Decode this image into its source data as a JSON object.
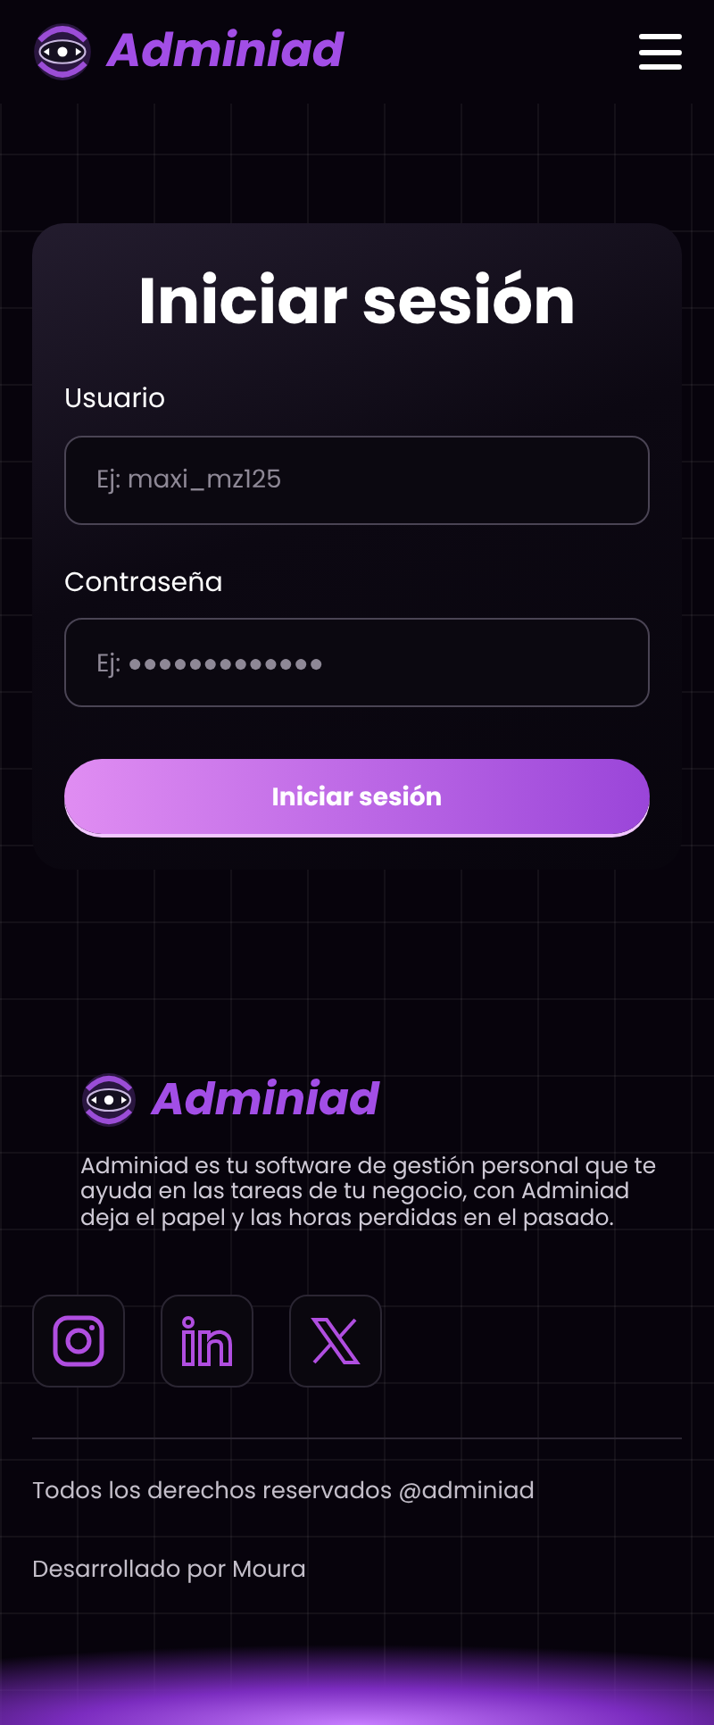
{
  "header": {
    "brand": "Adminiad"
  },
  "login": {
    "title": "Iniciar sesión",
    "fields": [
      {
        "label": "Usuario",
        "placeholder": "Ej: maxi_mz125"
      },
      {
        "label": "Contraseña",
        "placeholder": "Ej: ●●●●●●●●●●●●●"
      }
    ],
    "submit": "Iniciar sesión"
  },
  "footer": {
    "brand": "Adminiad",
    "description": "Adminiad es tu software de gestión personal que te ayuda en las tareas de tu negocio, con Adminiad deja el papel y las horas perdidas en el pasado.",
    "social": [
      {
        "kind": "instagram"
      },
      {
        "kind": "linkedin"
      },
      {
        "kind": "x"
      }
    ],
    "copyright": "Todos los derechos reservados @adminiad",
    "credit": "Desarrollado por Moura"
  }
}
